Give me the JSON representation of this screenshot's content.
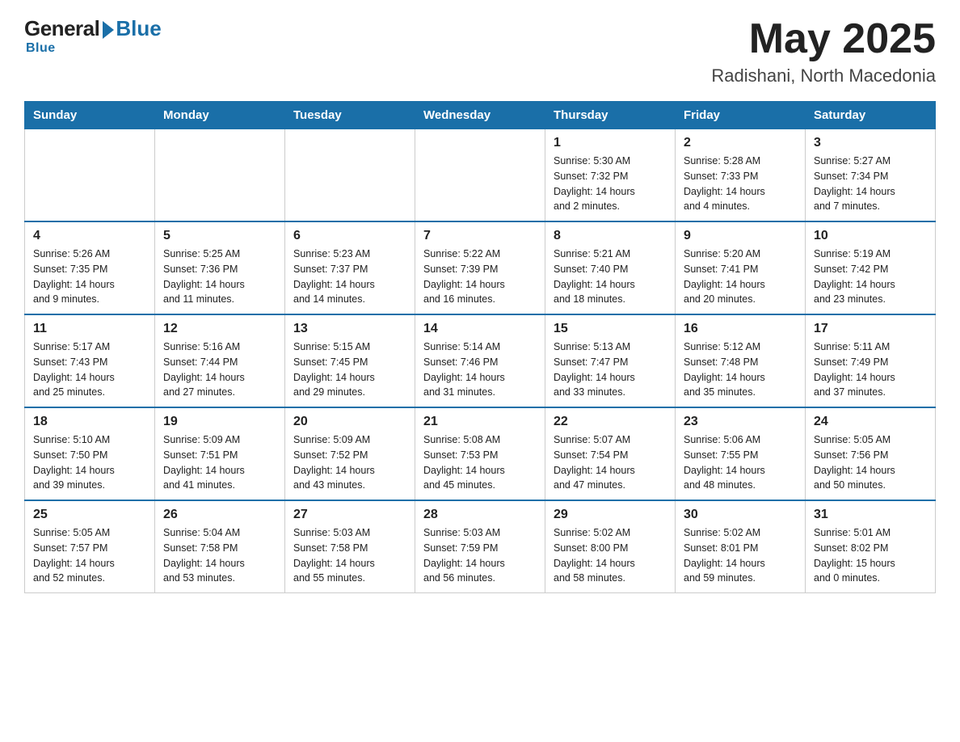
{
  "header": {
    "logo_general": "General",
    "logo_blue": "Blue",
    "month_year": "May 2025",
    "location": "Radishani, North Macedonia"
  },
  "weekdays": [
    "Sunday",
    "Monday",
    "Tuesday",
    "Wednesday",
    "Thursday",
    "Friday",
    "Saturday"
  ],
  "weeks": [
    [
      {
        "day": "",
        "info": ""
      },
      {
        "day": "",
        "info": ""
      },
      {
        "day": "",
        "info": ""
      },
      {
        "day": "",
        "info": ""
      },
      {
        "day": "1",
        "info": "Sunrise: 5:30 AM\nSunset: 7:32 PM\nDaylight: 14 hours\nand 2 minutes."
      },
      {
        "day": "2",
        "info": "Sunrise: 5:28 AM\nSunset: 7:33 PM\nDaylight: 14 hours\nand 4 minutes."
      },
      {
        "day": "3",
        "info": "Sunrise: 5:27 AM\nSunset: 7:34 PM\nDaylight: 14 hours\nand 7 minutes."
      }
    ],
    [
      {
        "day": "4",
        "info": "Sunrise: 5:26 AM\nSunset: 7:35 PM\nDaylight: 14 hours\nand 9 minutes."
      },
      {
        "day": "5",
        "info": "Sunrise: 5:25 AM\nSunset: 7:36 PM\nDaylight: 14 hours\nand 11 minutes."
      },
      {
        "day": "6",
        "info": "Sunrise: 5:23 AM\nSunset: 7:37 PM\nDaylight: 14 hours\nand 14 minutes."
      },
      {
        "day": "7",
        "info": "Sunrise: 5:22 AM\nSunset: 7:39 PM\nDaylight: 14 hours\nand 16 minutes."
      },
      {
        "day": "8",
        "info": "Sunrise: 5:21 AM\nSunset: 7:40 PM\nDaylight: 14 hours\nand 18 minutes."
      },
      {
        "day": "9",
        "info": "Sunrise: 5:20 AM\nSunset: 7:41 PM\nDaylight: 14 hours\nand 20 minutes."
      },
      {
        "day": "10",
        "info": "Sunrise: 5:19 AM\nSunset: 7:42 PM\nDaylight: 14 hours\nand 23 minutes."
      }
    ],
    [
      {
        "day": "11",
        "info": "Sunrise: 5:17 AM\nSunset: 7:43 PM\nDaylight: 14 hours\nand 25 minutes."
      },
      {
        "day": "12",
        "info": "Sunrise: 5:16 AM\nSunset: 7:44 PM\nDaylight: 14 hours\nand 27 minutes."
      },
      {
        "day": "13",
        "info": "Sunrise: 5:15 AM\nSunset: 7:45 PM\nDaylight: 14 hours\nand 29 minutes."
      },
      {
        "day": "14",
        "info": "Sunrise: 5:14 AM\nSunset: 7:46 PM\nDaylight: 14 hours\nand 31 minutes."
      },
      {
        "day": "15",
        "info": "Sunrise: 5:13 AM\nSunset: 7:47 PM\nDaylight: 14 hours\nand 33 minutes."
      },
      {
        "day": "16",
        "info": "Sunrise: 5:12 AM\nSunset: 7:48 PM\nDaylight: 14 hours\nand 35 minutes."
      },
      {
        "day": "17",
        "info": "Sunrise: 5:11 AM\nSunset: 7:49 PM\nDaylight: 14 hours\nand 37 minutes."
      }
    ],
    [
      {
        "day": "18",
        "info": "Sunrise: 5:10 AM\nSunset: 7:50 PM\nDaylight: 14 hours\nand 39 minutes."
      },
      {
        "day": "19",
        "info": "Sunrise: 5:09 AM\nSunset: 7:51 PM\nDaylight: 14 hours\nand 41 minutes."
      },
      {
        "day": "20",
        "info": "Sunrise: 5:09 AM\nSunset: 7:52 PM\nDaylight: 14 hours\nand 43 minutes."
      },
      {
        "day": "21",
        "info": "Sunrise: 5:08 AM\nSunset: 7:53 PM\nDaylight: 14 hours\nand 45 minutes."
      },
      {
        "day": "22",
        "info": "Sunrise: 5:07 AM\nSunset: 7:54 PM\nDaylight: 14 hours\nand 47 minutes."
      },
      {
        "day": "23",
        "info": "Sunrise: 5:06 AM\nSunset: 7:55 PM\nDaylight: 14 hours\nand 48 minutes."
      },
      {
        "day": "24",
        "info": "Sunrise: 5:05 AM\nSunset: 7:56 PM\nDaylight: 14 hours\nand 50 minutes."
      }
    ],
    [
      {
        "day": "25",
        "info": "Sunrise: 5:05 AM\nSunset: 7:57 PM\nDaylight: 14 hours\nand 52 minutes."
      },
      {
        "day": "26",
        "info": "Sunrise: 5:04 AM\nSunset: 7:58 PM\nDaylight: 14 hours\nand 53 minutes."
      },
      {
        "day": "27",
        "info": "Sunrise: 5:03 AM\nSunset: 7:58 PM\nDaylight: 14 hours\nand 55 minutes."
      },
      {
        "day": "28",
        "info": "Sunrise: 5:03 AM\nSunset: 7:59 PM\nDaylight: 14 hours\nand 56 minutes."
      },
      {
        "day": "29",
        "info": "Sunrise: 5:02 AM\nSunset: 8:00 PM\nDaylight: 14 hours\nand 58 minutes."
      },
      {
        "day": "30",
        "info": "Sunrise: 5:02 AM\nSunset: 8:01 PM\nDaylight: 14 hours\nand 59 minutes."
      },
      {
        "day": "31",
        "info": "Sunrise: 5:01 AM\nSunset: 8:02 PM\nDaylight: 15 hours\nand 0 minutes."
      }
    ]
  ]
}
